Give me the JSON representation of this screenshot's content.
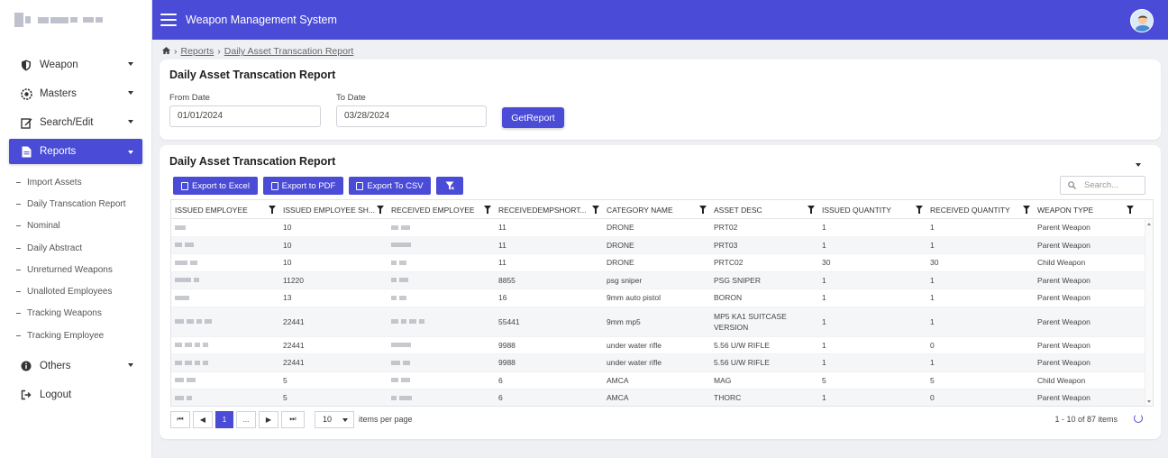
{
  "app": {
    "title": "Weapon Management System"
  },
  "sidebar": {
    "items": [
      {
        "label": "Weapon",
        "icon": "shield-icon"
      },
      {
        "label": "Masters",
        "icon": "settings-icon"
      },
      {
        "label": "Search/Edit",
        "icon": "edit-icon"
      },
      {
        "label": "Reports",
        "icon": "document-icon"
      }
    ],
    "subitems": [
      "Import Assets",
      "Daily Transcation Report",
      "Nominal",
      "Daily Abstract",
      "Unreturned Weapons",
      "Unalloted Employees",
      "Tracking Weapons",
      "Tracking Employee"
    ],
    "bottom": [
      {
        "label": "Others",
        "icon": "info-icon"
      },
      {
        "label": "Logout",
        "icon": "logout-icon"
      }
    ]
  },
  "breadcrumb": {
    "items": [
      "Reports",
      "Daily Asset Transcation Report"
    ]
  },
  "filter": {
    "title": "Daily Asset Transcation Report",
    "from_label": "From Date",
    "from_value": "01/01/2024",
    "to_label": "To Date",
    "to_value": "03/28/2024",
    "button": "GetReport"
  },
  "report": {
    "title": "Daily Asset Transcation Report",
    "export_excel": "Export to Excel",
    "export_pdf": "Export to PDF",
    "export_csv": "Export To CSV",
    "search_placeholder": "Search...",
    "columns": [
      "ISSUED EMPLOYEE",
      "ISSUED EMPLOYEE SH...",
      "RECEIVED EMPLOYEE",
      "RECEIVEDEMPSHORT...",
      "CATEGORY NAME",
      "ASSET DESC",
      "ISSUED QUANTITY",
      "RECEIVED QUANTITY",
      "WEAPON TYPE"
    ],
    "rows": [
      [
        "10",
        "11",
        "DRONE",
        "PRT02",
        "1",
        "1",
        "Parent Weapon"
      ],
      [
        "10",
        "11",
        "DRONE",
        "PRT03",
        "1",
        "1",
        "Parent Weapon"
      ],
      [
        "10",
        "11",
        "DRONE",
        "PRTC02",
        "30",
        "30",
        "Child Weapon"
      ],
      [
        "11220",
        "8855",
        "psg sniper",
        "PSG SNIPER",
        "1",
        "1",
        "Parent Weapon"
      ],
      [
        "13",
        "16",
        "9mm auto pistol",
        "BORON",
        "1",
        "1",
        "Parent Weapon"
      ],
      [
        "22441",
        "55441",
        "9mm mp5",
        "MP5 KA1 SUITCASE VERSION",
        "1",
        "1",
        "Parent Weapon"
      ],
      [
        "22441",
        "9988",
        "under water rifle",
        "5.56 U/W RIFLE",
        "1",
        "0",
        "Parent Weapon"
      ],
      [
        "22441",
        "9988",
        "under water rifle",
        "5.56 U/W RIFLE",
        "1",
        "1",
        "Parent Weapon"
      ],
      [
        "5",
        "6",
        "AMCA",
        "MAG",
        "5",
        "5",
        "Child Weapon"
      ],
      [
        "5",
        "6",
        "AMCA",
        "THORC",
        "1",
        "0",
        "Parent Weapon"
      ]
    ]
  },
  "pager": {
    "first": "⏮",
    "prev": "◀",
    "current": "1",
    "more": "...",
    "next": "▶",
    "last": "⏭",
    "page_size": "10",
    "page_size_label": "items per page",
    "info": "1 - 10 of 87 items"
  },
  "colors": {
    "accent": "#4a4bd6"
  }
}
